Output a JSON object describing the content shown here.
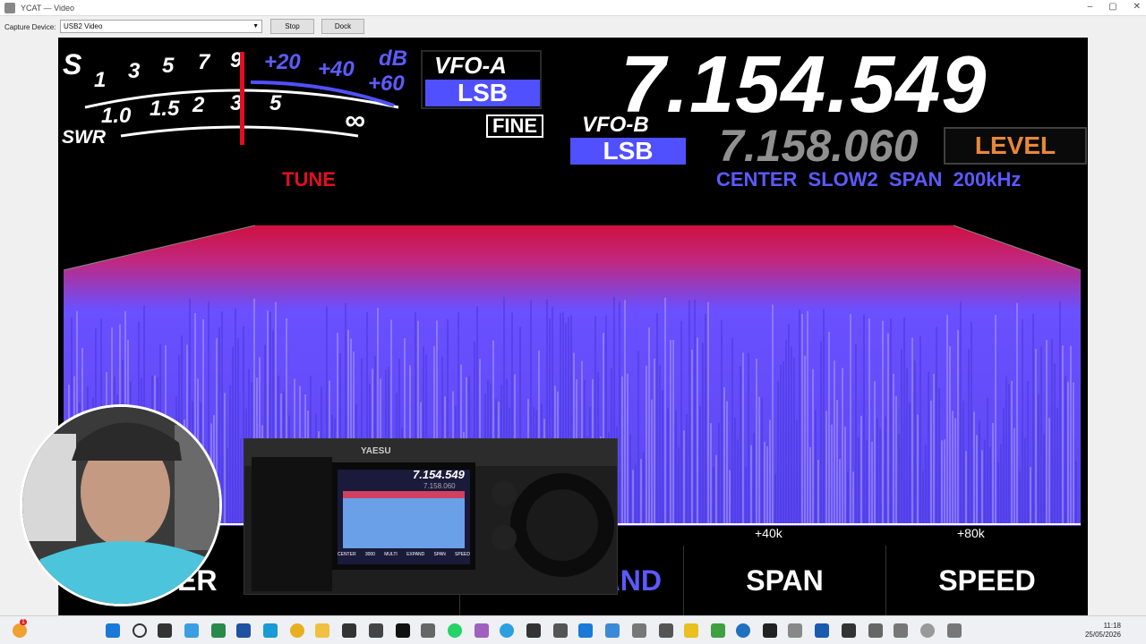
{
  "window": {
    "title": "YCAT — Video",
    "minimize": "–",
    "maximize": "▢",
    "close": "✕"
  },
  "toolbar": {
    "capture_label": "Capture Device:",
    "device_value": "USB2 Video",
    "stop_label": "Stop",
    "dock_label": "Dock"
  },
  "radio": {
    "s_letter": "S",
    "swr_label": "SWR",
    "s_scale": [
      "1",
      "3",
      "5",
      "7",
      "9"
    ],
    "db_scale": [
      "+20",
      "+40",
      "+60"
    ],
    "db_unit": "dB",
    "swr_scale": [
      "1.0",
      "1.5",
      "2",
      "3",
      "5",
      "∞"
    ],
    "vfo_a": "VFO-A",
    "mode_a": "LSB",
    "fine": "FINE",
    "vfo_b": "VFO-B",
    "mode_b": "LSB",
    "freq_main": "7.154.549",
    "freq_sub": "7.158.060",
    "level": "LEVEL",
    "status": "CENTER SLOW2 SPAN  200kHz",
    "tune": "TUNE",
    "scale_ticks": [
      "+40k",
      "+80k"
    ],
    "softkeys": [
      "ER",
      "XPAND",
      "SPAN",
      "SPEED"
    ],
    "colors": {
      "accent": "#5050ff",
      "tune": "#e01020",
      "level": "#e8883a",
      "spectrum": "#6a5cff"
    }
  },
  "inset": {
    "brand": "YAESU",
    "freq": "7.154.549",
    "sub": "7.158.060",
    "keys": [
      "CENTER",
      "3000",
      "MULTI",
      "EXPAND",
      "SPAN",
      "SPEED"
    ]
  },
  "taskbar": {
    "time": "11:18",
    "date": "25/05/2026",
    "badge": "1"
  }
}
